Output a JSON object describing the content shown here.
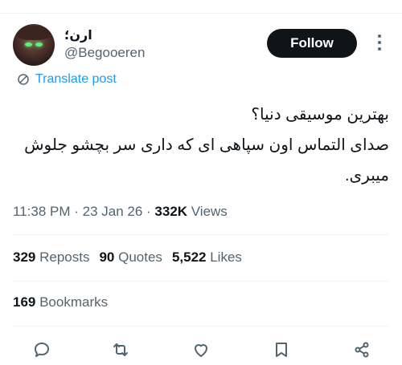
{
  "post": {
    "author": {
      "display_name": "ارن؛",
      "handle": "@Begooeren",
      "avatar_icon": "avatar-character-icon"
    },
    "follow_label": "Follow",
    "translate_label": "Translate post",
    "text_lines": [
      "بهترین موسیقی دنیا؟",
      "صدای التماس اون سپاهی ای که داری سر بچشو جلوش",
      "میبری."
    ],
    "timestamp": "11:38 PM · 23 Jan 26 · ",
    "views_count": "332K",
    "views_label": " Views"
  },
  "stats": {
    "reposts_count": "329",
    "reposts_label": " Reposts",
    "quotes_count": "90",
    "quotes_label": " Quotes",
    "likes_count": "5,522",
    "likes_label": " Likes",
    "bookmarks_count": "169",
    "bookmarks_label": " Bookmarks"
  },
  "actions": [
    "reply-icon",
    "repost-icon",
    "like-icon",
    "bookmark-icon",
    "share-icon"
  ],
  "colors": {
    "accent": "#1d9bf0",
    "text": "#0f1419",
    "secondary": "#536471",
    "follow_bg": "#0f1419"
  }
}
